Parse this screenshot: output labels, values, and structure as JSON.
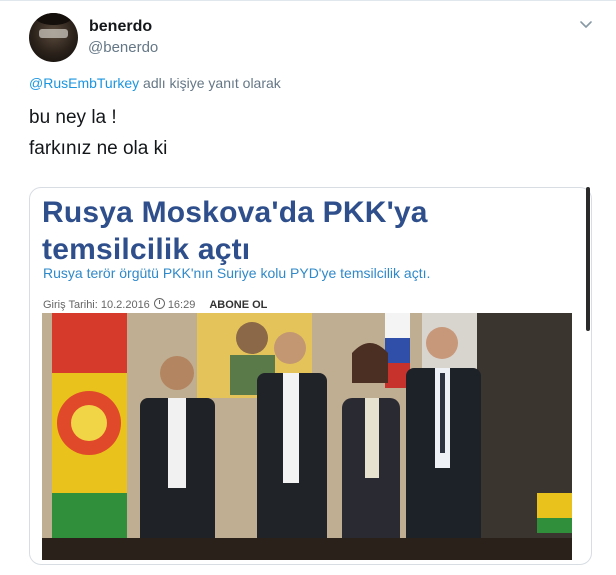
{
  "tweet": {
    "display_name": "benerdo",
    "handle": "@benerdo",
    "reply_mention": "@RusEmbTurkey",
    "reply_suffix": " adlı kişiye yanıt olarak",
    "text_line_1": "bu ney la !",
    "text_line_2": "farkınız ne ola ki"
  },
  "card": {
    "headline": "Rusya Moskova'da PKK'ya temsilcilik açtı",
    "subheadline": "Rusya terör örgütü PKK'nın Suriye kolu PYD'ye temsilcilik açtı.",
    "date_label": "Giriş Tarihi: 10.2.2016",
    "time": "16:29",
    "subscribe_label": "ABONE OL"
  },
  "icons": {
    "menu": "chevron-down-icon",
    "time": "clock-icon"
  },
  "colors": {
    "mention": "#1b95e0",
    "headline": "#2e4f8b",
    "subheadline": "#2f89c9",
    "secondary_text": "#657786"
  }
}
